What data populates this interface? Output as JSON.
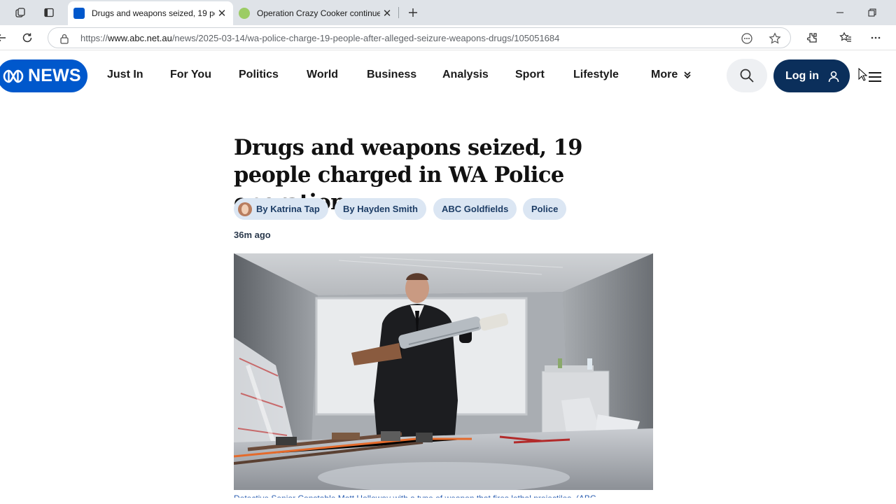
{
  "browser": {
    "tabs": [
      {
        "title": "Drugs and weapons seized, 19 pe",
        "active": true
      },
      {
        "title": "Operation Crazy Cooker continue",
        "active": false
      }
    ],
    "url": {
      "prefix": "https://",
      "host": "www.abc.net.au",
      "path": "/news/2025-03-14/wa-police-charge-19-people-after-alleged-seizure-weapons-drugs/105051684"
    }
  },
  "site": {
    "logo_text": "NEWS",
    "nav": [
      "Just In",
      "For You",
      "Politics",
      "World",
      "Business",
      "Analysis",
      "Sport",
      "Lifestyle",
      "More"
    ],
    "login_label": "Log in",
    "brand_color": "#0058cc",
    "login_color": "#0b2f5b"
  },
  "article": {
    "headline": "Drugs and weapons seized, 19 people charged in WA Police operation",
    "chips": [
      "By Katrina Tap",
      "By Hayden Smith",
      "ABC Goldfields",
      "Police"
    ],
    "timestamp": "36m ago",
    "caption": "Detective Senior Constable Matt Holloway with a type of weapon that fires lethal projectiles. (ABC"
  }
}
